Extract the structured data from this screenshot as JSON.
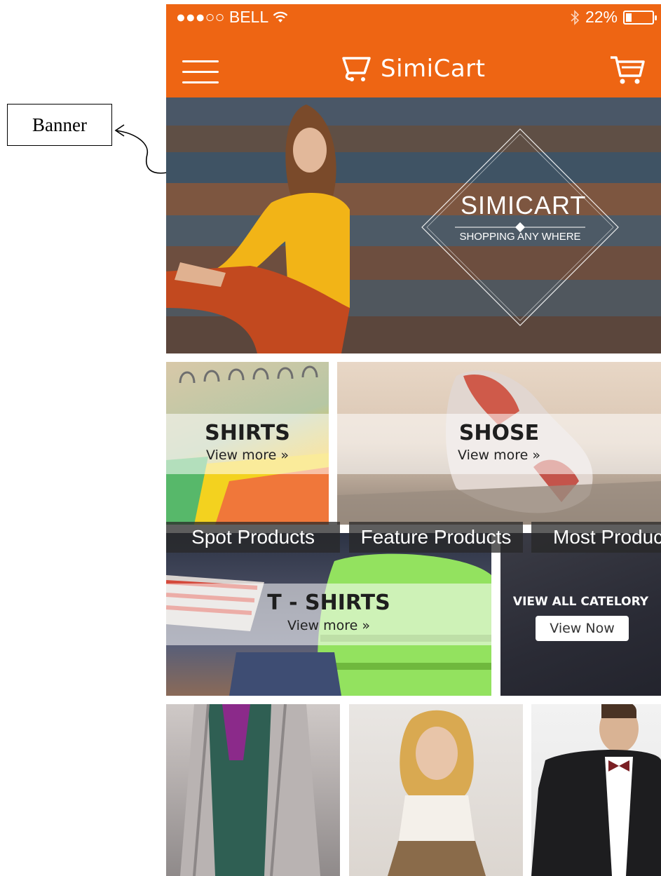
{
  "annotation": {
    "label": "Banner"
  },
  "status_bar": {
    "carrier": "●●●○○ BELL",
    "battery_percent": "22%",
    "battery_level": 0.22
  },
  "header": {
    "logo_text": "SimiCart",
    "menu_icon": "hamburger-icon",
    "cart_icon": "cart-icon",
    "accent_color": "#ee6513"
  },
  "banner": {
    "title": "SIMICART",
    "subtitle": "SHOPPING ANY WHERE"
  },
  "categories": [
    {
      "title": "SHIRTS",
      "more": "View more »"
    },
    {
      "title": "SHOSE",
      "more": "View more »"
    },
    {
      "title": "T - SHIRTS",
      "more": "View more »"
    }
  ],
  "view_all": {
    "title": "VIEW ALL CATELORY",
    "button": "View Now"
  },
  "products": [
    {
      "label": "Spot Products"
    },
    {
      "label": "Feature Products"
    },
    {
      "label": "Most Produc"
    }
  ]
}
